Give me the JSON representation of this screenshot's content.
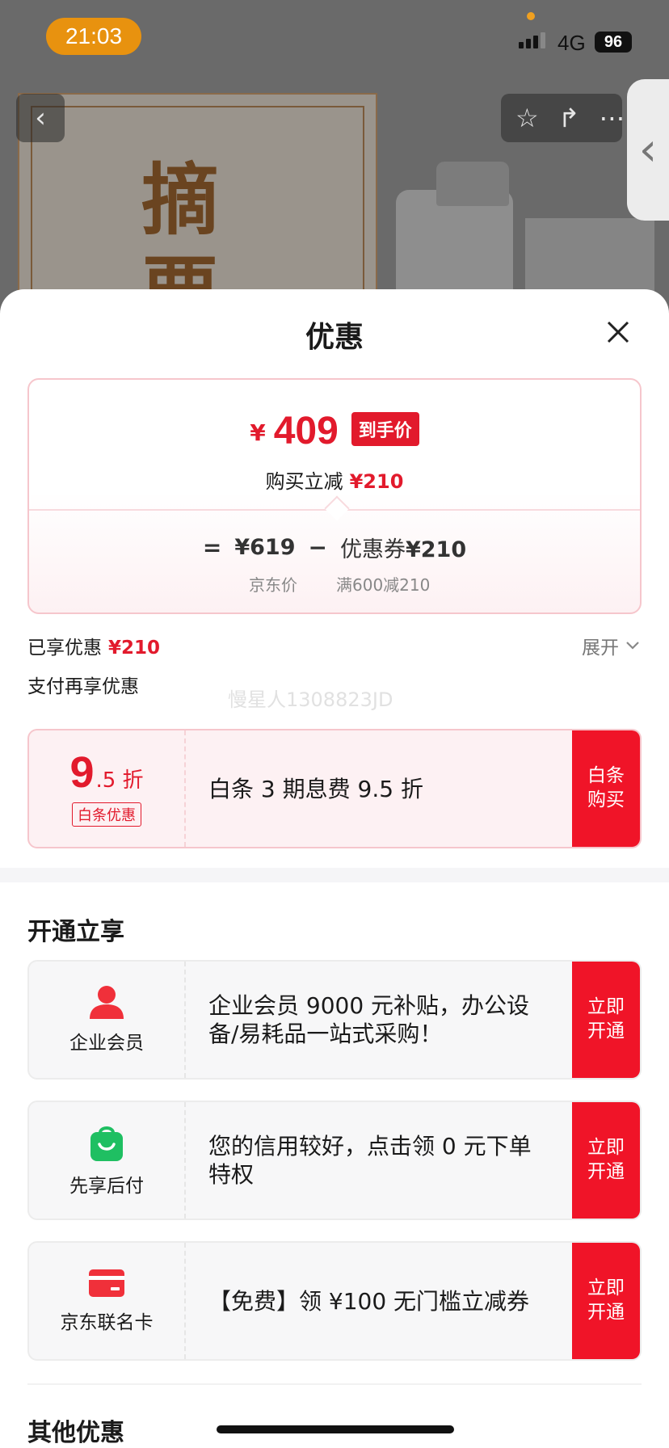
{
  "status_bar": {
    "time": "21:03",
    "network": "4G",
    "battery": "96"
  },
  "background": {
    "product_char_1": "摘",
    "product_char_2": "要",
    "back_icon_glyph": "‹",
    "star_icon_glyph": "☆",
    "share_icon_glyph": "↱",
    "more_icon_glyph": "⋯",
    "side_handle_glyph": "‹"
  },
  "sheet": {
    "title": "优惠",
    "price": {
      "currency": "¥",
      "final_price": "409",
      "final_badge": "到手价",
      "reduce_label": "购买立减",
      "reduce_amount": "¥210",
      "equals": "=",
      "jd_price": "¥619",
      "minus": "−",
      "coupon_label": "优惠券",
      "coupon_amount": "¥210",
      "jd_price_caption": "京东价",
      "coupon_caption": "满600减210"
    },
    "enjoyed_label": "已享优惠",
    "enjoyed_amount": "¥210",
    "expand_label": "展开",
    "pay_label": "支付再享优惠",
    "watermark": "慢星人1308823JD",
    "baitiao": {
      "discount_main": "9",
      "discount_sub": ".5 折",
      "tag": "白条优惠",
      "description": "白条 3 期息费 9.5 折",
      "button": "白条购买"
    },
    "open_section_title": "开通立享",
    "open_items": [
      {
        "icon": "user-icon",
        "label": "企业会员",
        "description": "企业会员 9000 元补贴，办公设备/易耗品一站式采购！",
        "button": "立即开通",
        "icon_color": "#f0303a"
      },
      {
        "icon": "shopping-bag-icon",
        "label": "先享后付",
        "description": "您的信用较好，点击领 0 元下单特权",
        "button": "立即开通",
        "icon_color": "#1fbf62"
      },
      {
        "icon": "credit-card-icon",
        "label": "京东联名卡",
        "description": "【免费】领 ¥100 无门槛立减券",
        "button": "立即开通",
        "icon_color": "#f0303a"
      }
    ],
    "other_section_title": "其他优惠"
  },
  "colors": {
    "accent_red": "#e21a2c",
    "button_red": "#f01428",
    "status_orange": "#e8920f",
    "green": "#1fbf62"
  }
}
